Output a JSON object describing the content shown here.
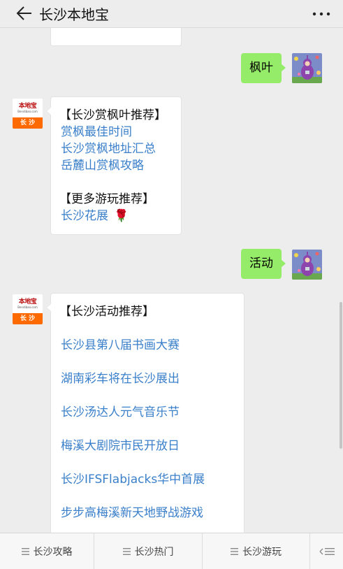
{
  "header": {
    "title": "长沙本地宝",
    "back_icon": "arrow-left-icon",
    "more_icon": "more-dots-icon"
  },
  "messages": [
    {
      "side": "right",
      "text": "枫叶",
      "avatar": "teletubby-avatar"
    },
    {
      "side": "left",
      "avatar_logo": {
        "main": "本地宝",
        "sub": "Bendibao.com",
        "city": "长 沙"
      },
      "lines": [
        {
          "kind": "heading",
          "text": "【长沙赏枫叶推荐】"
        },
        {
          "kind": "link",
          "text": "赏枫最佳时间"
        },
        {
          "kind": "link",
          "text": "长沙赏枫地址汇总"
        },
        {
          "kind": "link",
          "text": "岳麓山赏枫攻略"
        },
        {
          "kind": "heading",
          "text": "【更多游玩推荐】"
        },
        {
          "kind": "link",
          "text": "长沙花展",
          "emoji": "🌹"
        }
      ]
    },
    {
      "side": "right",
      "text": "活动",
      "avatar": "teletubby-avatar"
    },
    {
      "side": "left",
      "avatar_logo": {
        "main": "本地宝",
        "sub": "Bendibao.com",
        "city": "长 沙"
      },
      "lines": [
        {
          "kind": "heading",
          "text": "【长沙活动推荐】"
        },
        {
          "kind": "link",
          "text": "长沙县第八届书画大赛"
        },
        {
          "kind": "link",
          "text": "湖南彩车将在长沙展出"
        },
        {
          "kind": "link",
          "text": "长沙汤达人元气音乐节"
        },
        {
          "kind": "link",
          "text": "梅溪大剧院市民开放日"
        },
        {
          "kind": "link",
          "text": "长沙IFSFlabjacks华中首展"
        },
        {
          "kind": "link",
          "text": "步步高梅溪新天地野战游戏"
        }
      ]
    }
  ],
  "bottom_menu": {
    "items": [
      {
        "label": "长沙攻略",
        "icon": "menu-lines-icon"
      },
      {
        "label": "长沙热门",
        "icon": "menu-lines-icon"
      },
      {
        "label": "长沙游玩",
        "icon": "menu-lines-icon"
      }
    ],
    "switch_icon": "keyboard-switch-icon"
  },
  "colors": {
    "background": "#ededed",
    "bubble_sent": "#95ec69",
    "bubble_received": "#ffffff",
    "link": "#3a7fc9",
    "logo_orange": "#ff6a00"
  }
}
